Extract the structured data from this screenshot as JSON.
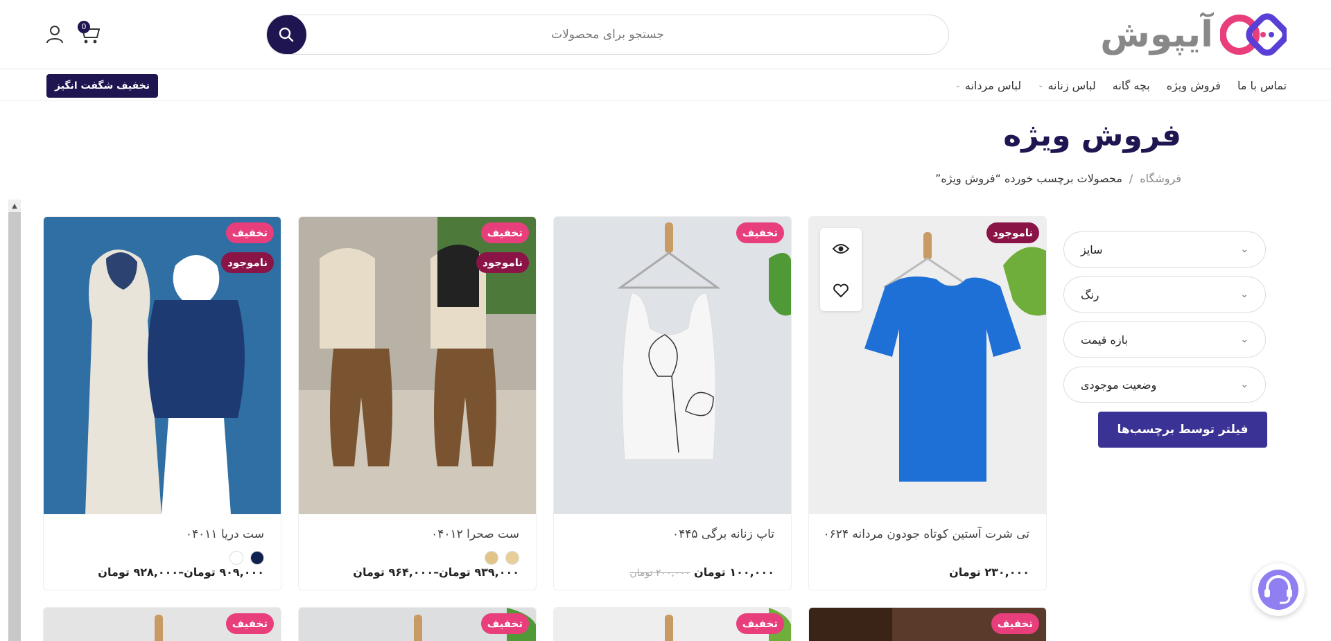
{
  "brand": {
    "name": "آیپوش",
    "accent": "#1f1550",
    "logo_pink": "#e83e7c",
    "logo_purple": "#5a3fd6"
  },
  "header": {
    "search": {
      "placeholder": "جستجو برای محصولات"
    },
    "cart": {
      "count": "0"
    }
  },
  "nav": {
    "items": [
      {
        "label": "لباس مردانه",
        "has_dropdown": true
      },
      {
        "label": "لباس زنانه",
        "has_dropdown": true
      },
      {
        "label": "بچه گانه",
        "has_dropdown": false
      },
      {
        "label": "فروش ویژه",
        "has_dropdown": false
      },
      {
        "label": "تماس با ما",
        "has_dropdown": false
      }
    ],
    "promo_label": "تخفیف شگفت انگیز"
  },
  "page": {
    "title": "فروش ویژه",
    "breadcrumb": {
      "home": "فروشگاه",
      "separator": "/",
      "current": "محصولات برچسب خورده “فروش ویژه”"
    }
  },
  "filters": {
    "items": [
      {
        "label": "سایز"
      },
      {
        "label": "رنگ"
      },
      {
        "label": "بازه قیمت"
      },
      {
        "label": "وضعیت موجودی"
      }
    ],
    "button_label": "فیلتر توسط برچسب‌ها"
  },
  "products": [
    {
      "name": "تی شرت آستین کوتاه جودون مردانه ۰۶۲۴",
      "badges": [
        "ناموجود"
      ],
      "price": "۲۳۰,۰۰۰ تومان",
      "old_price": "",
      "swatches": []
    },
    {
      "name": "تاپ زنانه برگی ۰۴۴۵",
      "badges": [
        "تخفیف"
      ],
      "price": "۱۰۰,۰۰۰ تومان",
      "old_price": "۲۰۰,۰۰۰ تومان",
      "swatches": []
    },
    {
      "name": "ست صحرا ۰۴۰۱۲",
      "badges": [
        "تخفیف",
        "ناموجود"
      ],
      "price": "۹۳۹,۰۰۰ تومان–۹۶۴,۰۰۰ تومان",
      "old_price": "",
      "swatches": [
        "#e8cf9a",
        "#e2c48a"
      ]
    },
    {
      "name": "ست دریا ۰۴۰۱۱",
      "badges": [
        "تخفیف",
        "ناموجود"
      ],
      "price": "۹۰۹,۰۰۰ تومان–۹۲۸,۰۰۰ تومان",
      "old_price": "",
      "swatches": [
        "#0f2250",
        "#ffffff"
      ]
    }
  ],
  "next_row_badges": [
    "تخفیف",
    "تخفیف",
    "تخفیف",
    "تخفیف"
  ]
}
